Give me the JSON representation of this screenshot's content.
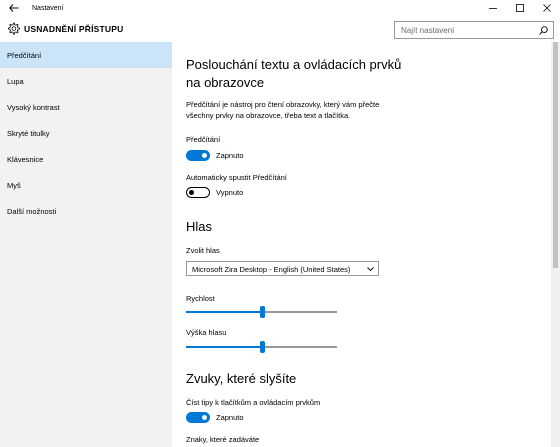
{
  "window": {
    "title": "Nastavení",
    "back_icon": "arrow-left-icon",
    "controls": [
      "minimize-icon",
      "maximize-icon",
      "close-icon"
    ]
  },
  "header": {
    "app_icon": "gear-icon",
    "title": "USNADNĚNÍ PŘÍSTUPU",
    "search_placeholder": "Najít nastavení",
    "search_icon": "search-icon"
  },
  "sidebar": {
    "items": [
      {
        "label": "Předčítání",
        "active": true
      },
      {
        "label": "Lupa",
        "active": false
      },
      {
        "label": "Vysoký kontrast",
        "active": false
      },
      {
        "label": "Skryté titulky",
        "active": false
      },
      {
        "label": "Klávesnice",
        "active": false
      },
      {
        "label": "Myš",
        "active": false
      },
      {
        "label": "Další možnosti",
        "active": false
      }
    ]
  },
  "main": {
    "heading": "Poslouchání textu a ovládacích prvků na obrazovce",
    "description": "Předčítání je nástroj pro čtení obrazovky, který vám přečte všechny prvky na obrazovce, třeba text a tlačítka.",
    "narrator": {
      "label": "Předčítání",
      "state_text": "Zapnuto",
      "on": true
    },
    "autostart": {
      "label": "Automaticky spustit Předčítání",
      "state_text": "Vypnuto",
      "on": false
    },
    "voice_heading": "Hlas",
    "voice": {
      "label": "Zvolit hlas",
      "value": "Microsoft Zira Desktop - English (United States)"
    },
    "speed": {
      "label": "Rychlost",
      "level": 0.5
    },
    "pitch": {
      "label": "Výška hlasu",
      "level": 0.5
    },
    "sounds_heading": "Zvuky, které slyšíte",
    "hints": {
      "label": "Číst tipy k tlačítkům a ovládacím prvkům",
      "state_text": "Zapnuto",
      "on": true
    },
    "chars_label": "Znaky, které zadáváte"
  },
  "colors": {
    "accent": "#0078d7",
    "sidebar_bg": "#f2f2f2",
    "selected_bg": "#cce4f7"
  }
}
